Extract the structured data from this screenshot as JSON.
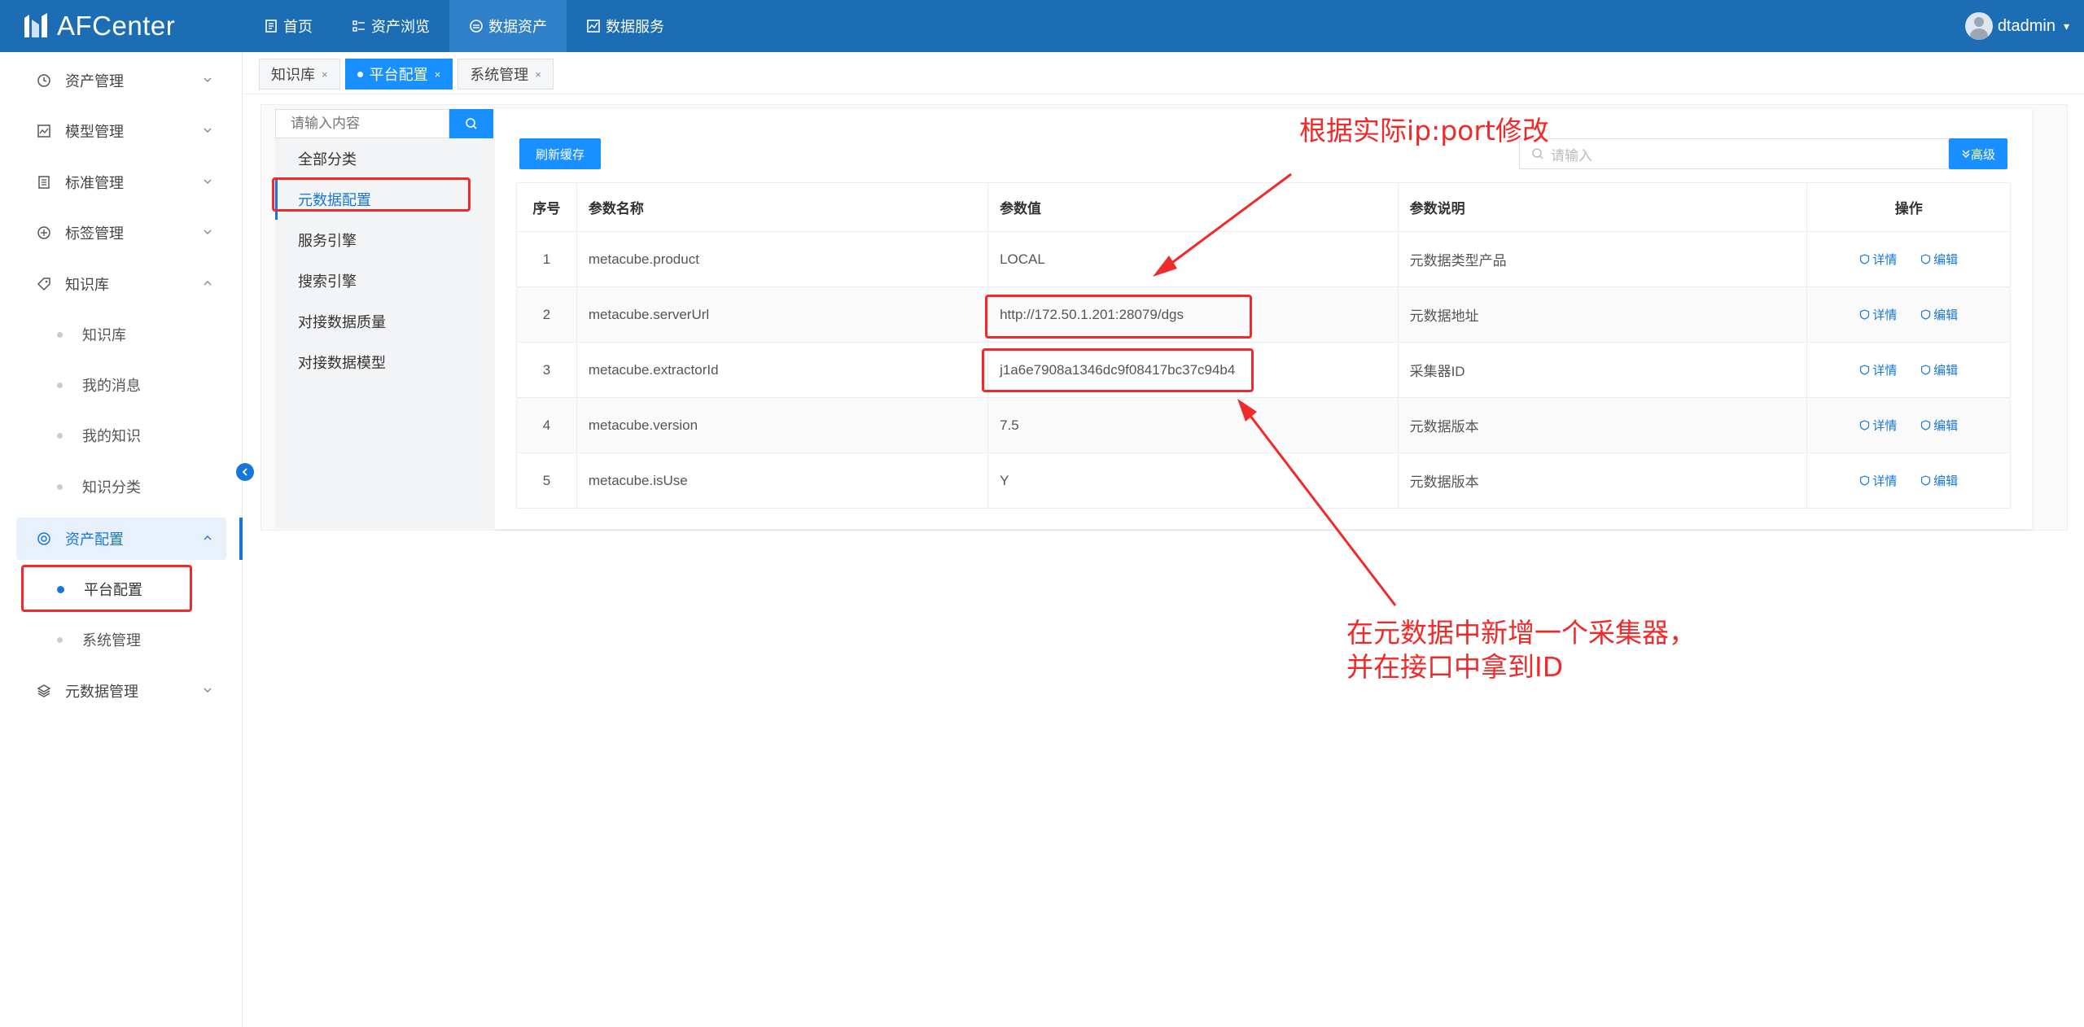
{
  "app": {
    "title": "AFCenter"
  },
  "topnav": [
    {
      "label": "首页",
      "icon": "document-icon"
    },
    {
      "label": "资产浏览",
      "icon": "list-icon"
    },
    {
      "label": "数据资产",
      "icon": "database-icon",
      "active": true
    },
    {
      "label": "数据服务",
      "icon": "chart-icon"
    }
  ],
  "user": {
    "name": "dtadmin"
  },
  "sidebar": {
    "groups": [
      {
        "label": "资产管理",
        "icon": "clock-icon"
      },
      {
        "label": "模型管理",
        "icon": "line-chart-icon"
      },
      {
        "label": "标准管理",
        "icon": "file-icon"
      },
      {
        "label": "标签管理",
        "icon": "plus-circle-icon"
      },
      {
        "label": "知识库",
        "icon": "tag-icon",
        "open": true
      },
      {
        "label": "资产配置",
        "icon": "target-icon",
        "open": true
      },
      {
        "label": "元数据管理",
        "icon": "layers-icon"
      }
    ],
    "knowledge_sub": [
      "知识库",
      "我的消息",
      "我的知识",
      "知识分类"
    ],
    "config_sub": [
      "平台配置",
      "系统管理"
    ]
  },
  "tabs": [
    {
      "label": "知识库",
      "close": "×"
    },
    {
      "label": "平台配置",
      "close": "×",
      "active": true
    },
    {
      "label": "系统管理",
      "close": "×"
    }
  ],
  "category": {
    "search_placeholder": "请输入内容",
    "items": [
      "全部分类",
      "元数据配置",
      "服务引擎",
      "搜索引擎",
      "对接数据质量",
      "对接数据模型"
    ]
  },
  "toolbar": {
    "refresh_label": "刷新缓存",
    "search_placeholder": "请输入",
    "advanced_label": "高级"
  },
  "table": {
    "headers": [
      "序号",
      "参数名称",
      "参数值",
      "参数说明",
      "操作"
    ],
    "rows": [
      {
        "no": "1",
        "name": "metacube.product",
        "value": "LOCAL",
        "desc": "元数据类型产品"
      },
      {
        "no": "2",
        "name": "metacube.serverUrl",
        "value": "http://172.50.1.201:28079/dgs",
        "desc": "元数据地址"
      },
      {
        "no": "3",
        "name": "metacube.extractorId",
        "value": "j1a6e7908a1346dc9f08417bc37c94b4",
        "desc": "采集器ID"
      },
      {
        "no": "4",
        "name": "metacube.version",
        "value": "7.5",
        "desc": "元数据版本"
      },
      {
        "no": "5",
        "name": "metacube.isUse",
        "value": "Y",
        "desc": "元数据版本"
      }
    ],
    "actions": {
      "detail": "详情",
      "edit": "编辑"
    }
  },
  "annotations": {
    "top": "根据实际ip:port修改",
    "bottom_line1": "在元数据中新增一个采集器，",
    "bottom_line2": "并在接口中拿到ID"
  },
  "colors": {
    "brand": "#1d6db4",
    "accent": "#1890ff",
    "annotation": "#f02a2a"
  }
}
